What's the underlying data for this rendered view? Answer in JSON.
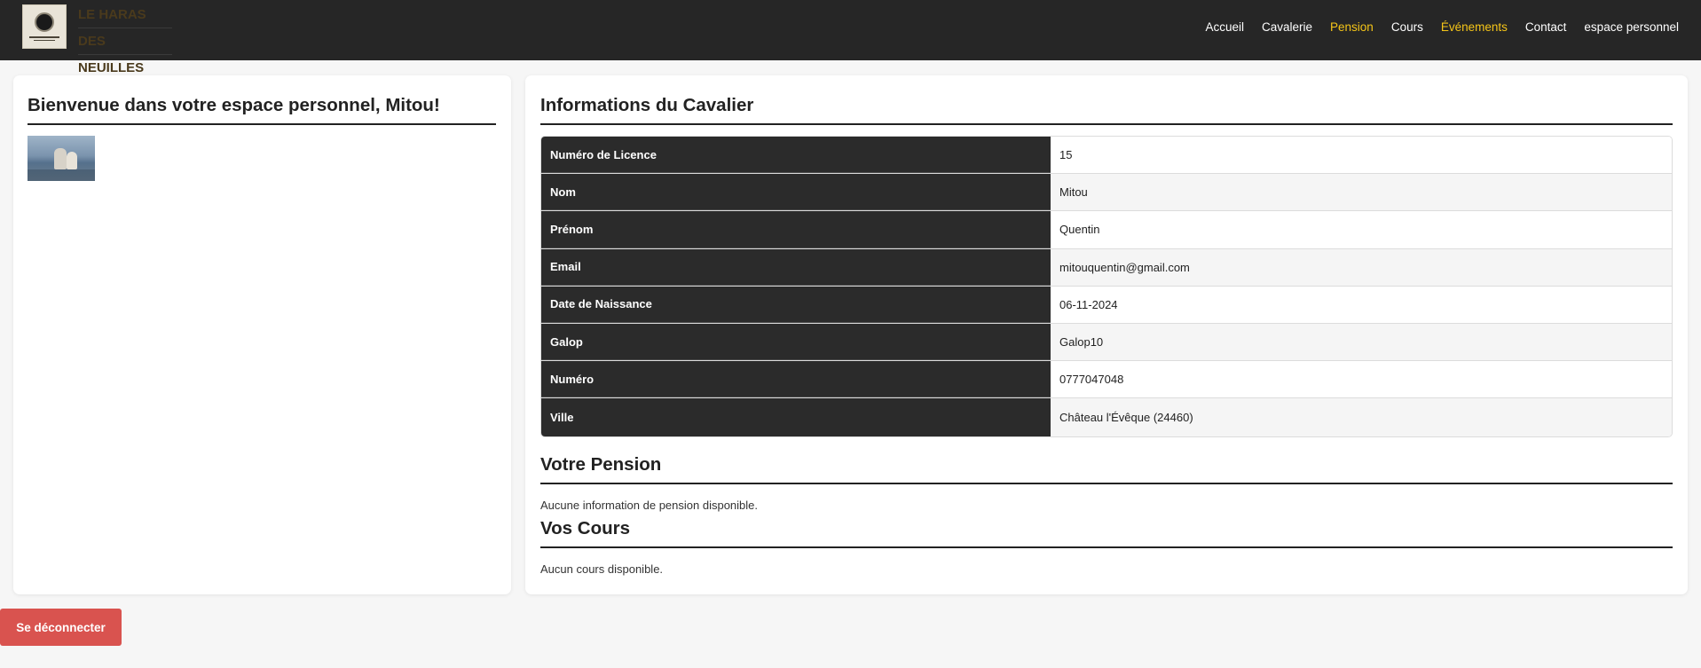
{
  "header": {
    "brand_line1": "LE HARAS",
    "brand_line2": "DES NEUILLES",
    "nav": [
      {
        "label": "Accueil",
        "active": false
      },
      {
        "label": "Cavalerie",
        "active": false
      },
      {
        "label": "Pension",
        "active": true
      },
      {
        "label": "Cours",
        "active": false
      },
      {
        "label": "Événements",
        "active": true
      },
      {
        "label": "Contact",
        "active": false
      },
      {
        "label": "espace personnel",
        "active": false
      }
    ]
  },
  "welcome": {
    "title": "Bienvenue dans votre espace personnel, Mitou!"
  },
  "rider": {
    "title": "Informations du Cavalier",
    "rows": [
      {
        "label": "Numéro de Licence",
        "value": "15"
      },
      {
        "label": "Nom",
        "value": "Mitou"
      },
      {
        "label": "Prénom",
        "value": "Quentin"
      },
      {
        "label": "Email",
        "value": "mitouquentin@gmail.com"
      },
      {
        "label": "Date de Naissance",
        "value": "06-11-2024"
      },
      {
        "label": "Galop",
        "value": "Galop10"
      },
      {
        "label": "Numéro",
        "value": "0777047048"
      },
      {
        "label": "Ville",
        "value": "Château l'Évêque (24460)"
      }
    ]
  },
  "pension": {
    "title": "Votre Pension",
    "message": "Aucune information de pension disponible."
  },
  "cours": {
    "title": "Vos Cours",
    "message": "Aucun cours disponible."
  },
  "logout_label": "Se déconnecter",
  "colors": {
    "topbar": "#262626",
    "nav_active": "#f5c518",
    "table_header": "#2b2b2b",
    "logout": "#d9534f"
  }
}
